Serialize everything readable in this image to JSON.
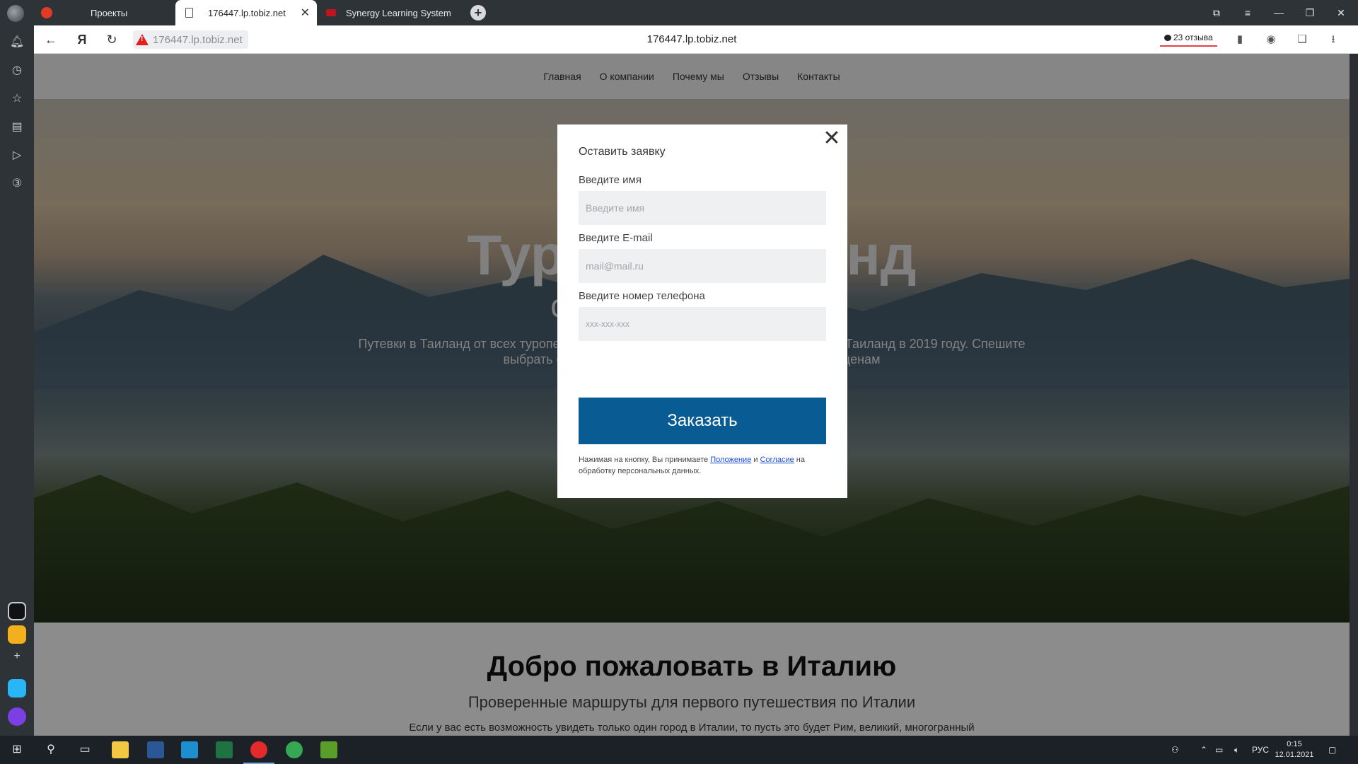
{
  "browser": {
    "tabs": [
      {
        "label": "Проекты"
      },
      {
        "label": "176447.lp.tobiz.net"
      },
      {
        "label": "Synergy Learning System"
      }
    ],
    "address": {
      "url_chip": "176447.lp.tobiz.net",
      "page_title": "176447.lp.tobiz.net",
      "reviews": "23 отзыва"
    }
  },
  "site": {
    "nav": [
      "Главная",
      "О компании",
      "Почему мы",
      "Отзывы",
      "Контакты"
    ],
    "hero": {
      "title": "Туры в Таиланд",
      "subtitle": "со скидкой до 50%",
      "description": "Путевки в Таиланд от всех туроператоров. Мы подобрали для вас лучшие туры в Таиланд в 2019 году. Спешите выбрать оптимальный вариант отдыха по самым низким ценам"
    },
    "welcome": {
      "title": "Добро пожаловать в Италию",
      "subtitle": "Проверенные маршруты для первого путешествия по Италии",
      "body": "Если у вас есть возможность увидеть только один город в Италии, то пусть это будет Рим, великий, многогранный"
    }
  },
  "modal": {
    "title": "Оставить заявку",
    "name_label": "Введите имя",
    "name_placeholder": "Введите имя",
    "email_label": "Введите E-mail",
    "email_placeholder": "mail@mail.ru",
    "phone_label": "Введите номер телефона",
    "phone_placeholder": "xxx-xxx-xxx",
    "submit": "Заказать",
    "consent_before": "Нажимая на кнопку, Вы принимаете ",
    "consent_link1": "Положение",
    "consent_and": " и ",
    "consent_link2": "Согласие",
    "consent_after": " на обработку персональных данных."
  },
  "taskbar": {
    "lang": "РУС",
    "time": "0:15",
    "date": "12.01.2021"
  },
  "colors": {
    "accent_button": "#095c93",
    "link": "#1a4fd6",
    "scroll_thumb": "#1e78c8"
  }
}
